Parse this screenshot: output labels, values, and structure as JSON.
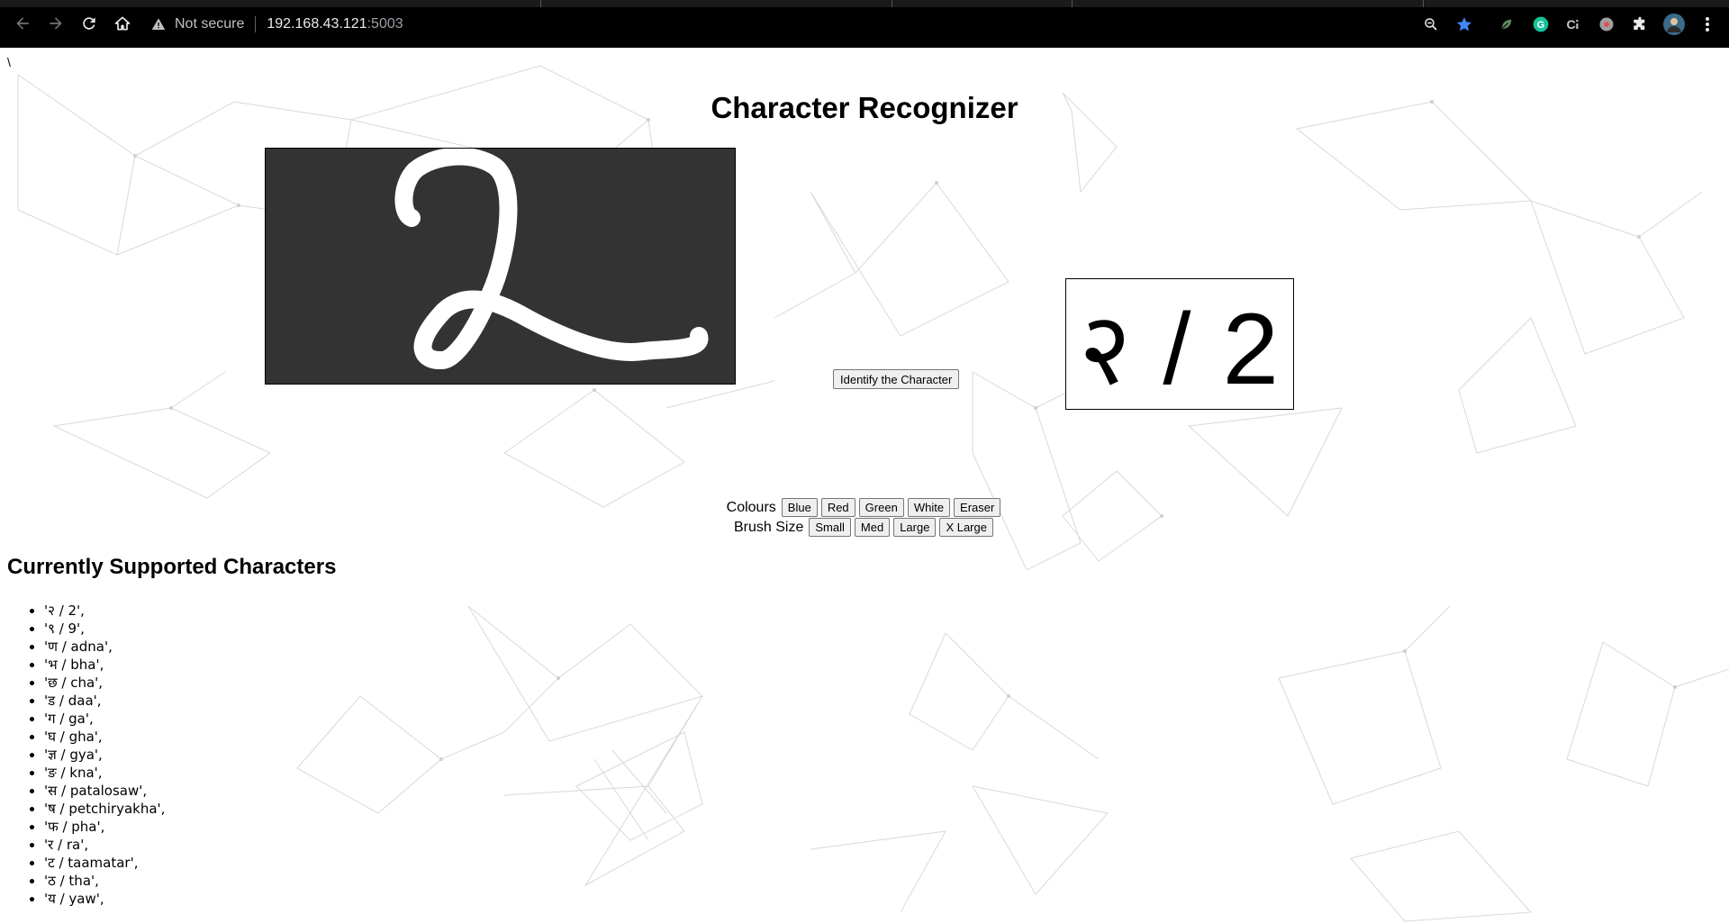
{
  "browser": {
    "security_label": "Not secure",
    "host": "192.168.43.121",
    "port": ":5003"
  },
  "page": {
    "stray_text": "\\",
    "title": "Character Recognizer",
    "identify_label": "Identify the Character",
    "result_text": "२ / 2",
    "colours": {
      "label": "Colours",
      "buttons": [
        "Blue",
        "Red",
        "Green",
        "White",
        "Eraser"
      ]
    },
    "brush": {
      "label": "Brush Size",
      "buttons": [
        "Small",
        "Med",
        "Large",
        "X Large"
      ]
    },
    "supported_heading": "Currently Supported Characters",
    "characters": [
      "'२ / 2',",
      "'९ / 9',",
      "'ण / adna',",
      "'भ / bha',",
      "'छ / cha',",
      "'ड / daa',",
      "'ग / ga',",
      "'घ / gha',",
      "'ज्ञ / gya',",
      "'ङ / kna',",
      "'स / patalosaw',",
      "'ष / petchiryakha',",
      "'फ / pha',",
      "'र / ra',",
      "'ट / taamatar',",
      "'ठ / tha',",
      "'य / yaw',"
    ]
  },
  "colors": {
    "chrome_bg": "#000000",
    "canvas_bg": "#333333",
    "stroke": "#ffffff",
    "bookmark_star": "#4285f4",
    "grammarly": "#15c39a"
  }
}
